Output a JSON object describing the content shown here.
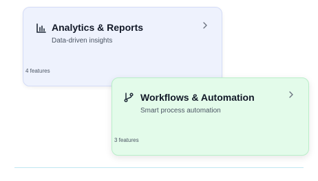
{
  "cards": [
    {
      "icon": "bar-chart-icon",
      "title": "Analytics & Reports",
      "subtitle": "Data-driven insights",
      "count": "4 features",
      "accent": "#eef2fd"
    },
    {
      "icon": "git-branch-icon",
      "title": "Workflows & Automation",
      "subtitle": "Smart process automation",
      "count": "3 features",
      "accent": "#e3fbea"
    }
  ],
  "chevron_icon": "chevron-right-icon"
}
